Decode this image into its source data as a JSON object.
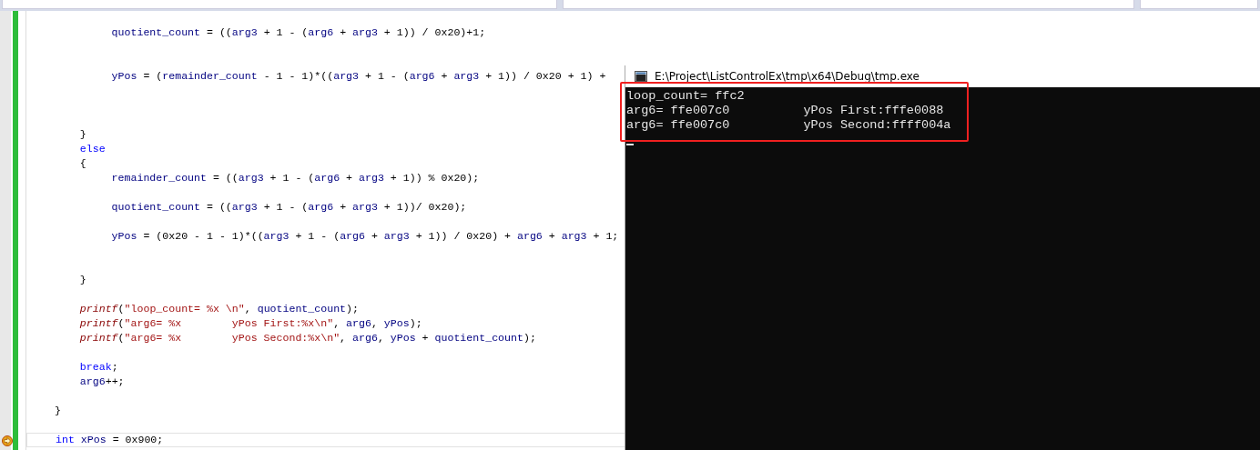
{
  "editor": {
    "lines": [
      {
        "kind": "blank",
        "current": false
      },
      {
        "kind": "code",
        "current": false,
        "tokens": [
          {
            "kind": "ident",
            "text": "         quotient_count"
          },
          {
            "kind": "plain",
            "text": " = (("
          },
          {
            "kind": "ident",
            "text": "arg3"
          },
          {
            "kind": "plain",
            "text": " + 1 - ("
          },
          {
            "kind": "ident",
            "text": "arg6"
          },
          {
            "kind": "plain",
            "text": " + "
          },
          {
            "kind": "ident",
            "text": "arg3"
          },
          {
            "kind": "plain",
            "text": " + 1)) / 0x20)+1;"
          }
        ]
      },
      {
        "kind": "blank",
        "current": false
      },
      {
        "kind": "blank",
        "current": false
      },
      {
        "kind": "code",
        "current": false,
        "tokens": [
          {
            "kind": "ident",
            "text": "         yPos"
          },
          {
            "kind": "plain",
            "text": " = ("
          },
          {
            "kind": "ident",
            "text": "remainder_count"
          },
          {
            "kind": "plain",
            "text": " - 1 - 1)*(("
          },
          {
            "kind": "ident",
            "text": "arg3"
          },
          {
            "kind": "plain",
            "text": " + 1 - ("
          },
          {
            "kind": "ident",
            "text": "arg6"
          },
          {
            "kind": "plain",
            "text": " + "
          },
          {
            "kind": "ident",
            "text": "arg3"
          },
          {
            "kind": "plain",
            "text": " + 1)) / 0x20 + 1) +"
          }
        ]
      },
      {
        "kind": "blank",
        "current": false
      },
      {
        "kind": "blank",
        "current": false
      },
      {
        "kind": "blank",
        "current": false
      },
      {
        "kind": "code",
        "current": false,
        "tokens": [
          {
            "kind": "plain",
            "text": "    }"
          }
        ]
      },
      {
        "kind": "code",
        "current": false,
        "tokens": [
          {
            "kind": "keyword",
            "text": "    else"
          }
        ]
      },
      {
        "kind": "code",
        "current": false,
        "tokens": [
          {
            "kind": "plain",
            "text": "    {"
          }
        ]
      },
      {
        "kind": "code",
        "current": false,
        "tokens": [
          {
            "kind": "ident",
            "text": "         remainder_count"
          },
          {
            "kind": "plain",
            "text": " = (("
          },
          {
            "kind": "ident",
            "text": "arg3"
          },
          {
            "kind": "plain",
            "text": " + 1 - ("
          },
          {
            "kind": "ident",
            "text": "arg6"
          },
          {
            "kind": "plain",
            "text": " + "
          },
          {
            "kind": "ident",
            "text": "arg3"
          },
          {
            "kind": "plain",
            "text": " + 1)) % 0x20);"
          }
        ]
      },
      {
        "kind": "blank",
        "current": false
      },
      {
        "kind": "code",
        "current": false,
        "tokens": [
          {
            "kind": "ident",
            "text": "         quotient_count"
          },
          {
            "kind": "plain",
            "text": " = (("
          },
          {
            "kind": "ident",
            "text": "arg3"
          },
          {
            "kind": "plain",
            "text": " + 1 - ("
          },
          {
            "kind": "ident",
            "text": "arg6"
          },
          {
            "kind": "plain",
            "text": " + "
          },
          {
            "kind": "ident",
            "text": "arg3"
          },
          {
            "kind": "plain",
            "text": " + 1))/ 0x20);"
          }
        ]
      },
      {
        "kind": "blank",
        "current": false
      },
      {
        "kind": "code",
        "current": false,
        "tokens": [
          {
            "kind": "ident",
            "text": "         yPos"
          },
          {
            "kind": "plain",
            "text": " = (0x20 - 1 - 1)*(("
          },
          {
            "kind": "ident",
            "text": "arg3"
          },
          {
            "kind": "plain",
            "text": " + 1 - ("
          },
          {
            "kind": "ident",
            "text": "arg6"
          },
          {
            "kind": "plain",
            "text": " + "
          },
          {
            "kind": "ident",
            "text": "arg3"
          },
          {
            "kind": "plain",
            "text": " + 1)) / 0x20) + "
          },
          {
            "kind": "ident",
            "text": "arg6"
          },
          {
            "kind": "plain",
            "text": " + "
          },
          {
            "kind": "ident",
            "text": "arg3"
          },
          {
            "kind": "plain",
            "text": " + 1;"
          }
        ]
      },
      {
        "kind": "blank",
        "current": false
      },
      {
        "kind": "blank",
        "current": false
      },
      {
        "kind": "code",
        "current": false,
        "tokens": [
          {
            "kind": "plain",
            "text": "    }"
          }
        ]
      },
      {
        "kind": "blank",
        "current": false
      },
      {
        "kind": "code",
        "current": false,
        "tokens": [
          {
            "kind": "func",
            "text": "    printf"
          },
          {
            "kind": "plain",
            "text": "("
          },
          {
            "kind": "string",
            "text": "\"loop_count= %x \\n\""
          },
          {
            "kind": "plain",
            "text": ", "
          },
          {
            "kind": "ident",
            "text": "quotient_count"
          },
          {
            "kind": "plain",
            "text": ");"
          }
        ]
      },
      {
        "kind": "code",
        "current": false,
        "tokens": [
          {
            "kind": "func",
            "text": "    printf"
          },
          {
            "kind": "plain",
            "text": "("
          },
          {
            "kind": "string",
            "text": "\"arg6= %x        yPos First:%x\\n\""
          },
          {
            "kind": "plain",
            "text": ", "
          },
          {
            "kind": "ident",
            "text": "arg6"
          },
          {
            "kind": "plain",
            "text": ", "
          },
          {
            "kind": "ident",
            "text": "yPos"
          },
          {
            "kind": "plain",
            "text": ");"
          }
        ]
      },
      {
        "kind": "code",
        "current": false,
        "tokens": [
          {
            "kind": "func",
            "text": "    printf"
          },
          {
            "kind": "plain",
            "text": "("
          },
          {
            "kind": "string",
            "text": "\"arg6= %x        yPos Second:%x\\n\""
          },
          {
            "kind": "plain",
            "text": ", "
          },
          {
            "kind": "ident",
            "text": "arg6"
          },
          {
            "kind": "plain",
            "text": ", "
          },
          {
            "kind": "ident",
            "text": "yPos"
          },
          {
            "kind": "plain",
            "text": " + "
          },
          {
            "kind": "ident",
            "text": "quotient_count"
          },
          {
            "kind": "plain",
            "text": ");"
          }
        ]
      },
      {
        "kind": "blank",
        "current": false
      },
      {
        "kind": "code",
        "current": false,
        "tokens": [
          {
            "kind": "keyword",
            "text": "    break"
          },
          {
            "kind": "plain",
            "text": ";"
          }
        ]
      },
      {
        "kind": "code",
        "current": false,
        "tokens": [
          {
            "kind": "ident",
            "text": "    arg6"
          },
          {
            "kind": "plain",
            "text": "++;"
          }
        ]
      },
      {
        "kind": "blank",
        "current": false
      },
      {
        "kind": "code",
        "current": false,
        "tokens": [
          {
            "kind": "plain",
            "text": "}"
          }
        ]
      },
      {
        "kind": "blank",
        "current": false
      },
      {
        "kind": "code",
        "current": true,
        "tokens": [
          {
            "kind": "keyword",
            "text": "int"
          },
          {
            "kind": "ident",
            "text": " xPos"
          },
          {
            "kind": "plain",
            "text": " = 0x900;"
          }
        ]
      }
    ]
  },
  "console": {
    "title": "E:\\Project\\ListControlEx\\tmp\\x64\\Debug\\tmp.exe",
    "output": [
      "loop_count= ffc2",
      "arg6= ffe007c0          yPos First:fffe0088",
      "arg6= ffe007c0          yPos Second:ffff004a"
    ]
  }
}
